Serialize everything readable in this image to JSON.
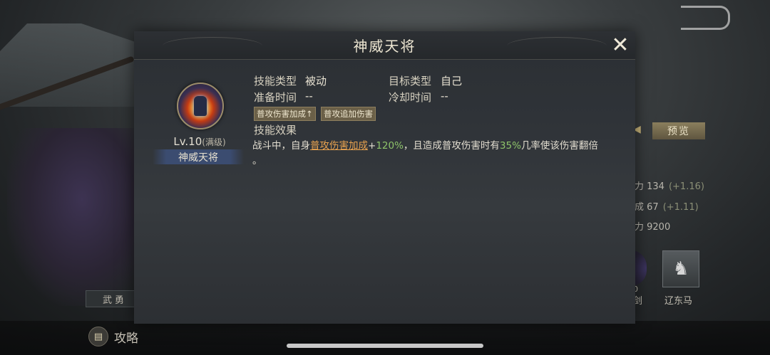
{
  "background": {
    "bottom_left_label": "武勇",
    "guide_label": "攻略",
    "guide_icon": "book-icon",
    "preview_button": "预览",
    "stats": [
      {
        "label": "力 134",
        "delta": "(+1.16)"
      },
      {
        "label": "成 67",
        "delta": "(+1.11)"
      },
      {
        "label": "力 9200",
        "delta": ""
      }
    ],
    "equipment": [
      {
        "label": "双剑",
        "icon": "sword-icon",
        "level": "0"
      },
      {
        "label": "辽东马",
        "icon": "horse-icon"
      }
    ]
  },
  "dialog": {
    "title": "神威天将",
    "close_icon": "close-x-icon",
    "skill": {
      "icon": "skill-general-icon",
      "level": "Lv.10",
      "level_note": "(满级)",
      "name": "神威天将"
    },
    "fields": {
      "type_label": "技能类型",
      "type_value": "被动",
      "target_label": "目标类型",
      "target_value": "自己",
      "prep_label": "准备时间",
      "prep_value": "--",
      "cooldown_label": "冷却时间",
      "cooldown_value": "--"
    },
    "tags": [
      "普攻伤害加成↑",
      "普攻追加伤害"
    ],
    "effect_label": "技能效果",
    "description": {
      "part1": "战斗中，自身",
      "link": "普攻伤害加成",
      "part2": "+",
      "value1": "120%",
      "part3": "，且造成普攻伤害时有",
      "value2": "35%",
      "part4": "几率使该伤害翻倍",
      "part5": "。"
    },
    "colors": {
      "link": "#e8a24f",
      "value": "#8ec36a"
    }
  }
}
